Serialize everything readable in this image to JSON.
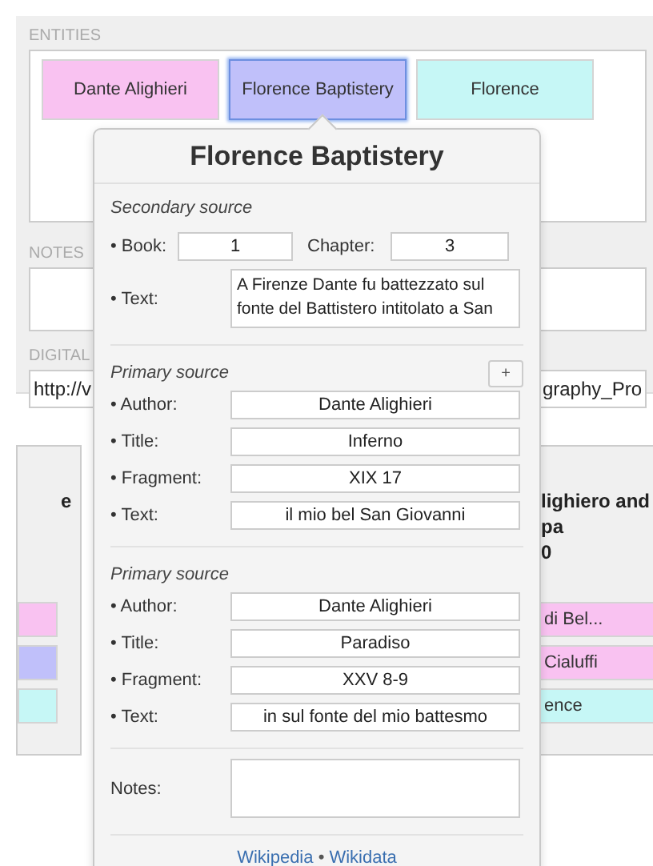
{
  "labels": {
    "entities": "ENTITIES",
    "notes": "NOTES",
    "digital": "DIGITAL"
  },
  "entities": [
    {
      "label": "Dante Alighieri",
      "color": "#f9c2f1",
      "selected": false
    },
    {
      "label": "Florence Baptistery",
      "color": "#c0c0fa",
      "selected": true
    },
    {
      "label": "Florence",
      "color": "#c6f7f6",
      "selected": false
    }
  ],
  "url": {
    "start": "http://v",
    "end": "graphy_Pro"
  },
  "cards": [
    {
      "title_lines": [
        "e"
      ],
      "chips": [
        {
          "color": "#f9c2f1"
        },
        {
          "color": "#c0c0fa"
        },
        {
          "color": "#c6f7f6"
        }
      ]
    },
    {
      "title_lines": [
        "lighiero and",
        "pa",
        "0"
      ],
      "chips": [
        {
          "label": "di Bel...",
          "color": "#f9c2f1"
        },
        {
          "label": "Cialuffi",
          "color": "#f9c2f1"
        },
        {
          "label": "ence",
          "color": "#c6f7f6"
        }
      ]
    }
  ],
  "popover": {
    "title": "Florence Baptistery",
    "secondary_source": {
      "heading": "Secondary source",
      "book_label": "• Book:",
      "book": "1",
      "chapter_label": "Chapter:",
      "chapter": "3",
      "text_label": "• Text:",
      "text": "A Firenze Dante fu battezzato sul fonte del Battistero intitolato a San"
    },
    "primary_sources": [
      {
        "heading": "Primary source",
        "add_button": "+",
        "fields": [
          {
            "label": "• Author:",
            "value": "Dante Alighieri"
          },
          {
            "label": "• Title:",
            "value": "Inferno"
          },
          {
            "label": "• Fragment:",
            "value": "XIX 17"
          },
          {
            "label": "• Text:",
            "value": "il mio bel San Giovanni"
          }
        ]
      },
      {
        "heading": "Primary source",
        "fields": [
          {
            "label": "• Author:",
            "value": "Dante Alighieri"
          },
          {
            "label": "• Title:",
            "value": "Paradiso"
          },
          {
            "label": "• Fragment:",
            "value": "XXV 8-9"
          },
          {
            "label": "• Text:",
            "value": "in sul fonte del mio battesmo"
          }
        ]
      }
    ],
    "notes_label": "Notes:",
    "links": [
      "Wikipedia",
      "Wikidata"
    ],
    "link_separator": "•"
  }
}
